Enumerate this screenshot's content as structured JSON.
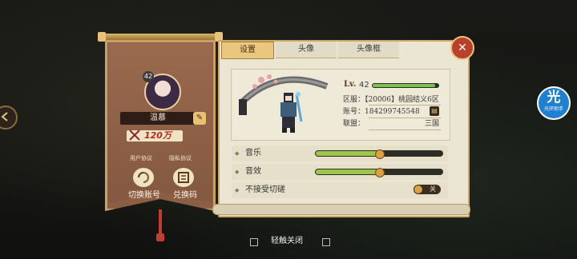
{
  "profile": {
    "level": "42",
    "name": "温慕",
    "power": "120万",
    "links": {
      "user_agreement": "用户协议",
      "privacy": "隐私协议"
    },
    "switch_account": "切换账号",
    "redeem_code": "兑换码"
  },
  "tabs": [
    {
      "label": "设置",
      "active": true
    },
    {
      "label": "头像",
      "active": false
    },
    {
      "label": "头像框",
      "active": false
    }
  ],
  "player": {
    "level_prefix": "Lv.",
    "level": "42",
    "xp_fraction": 0.95,
    "server": "区服：【20006】桃园结义6区",
    "account": "账号：184299745548",
    "alliance_label": "联盟：",
    "alliance_value": "三国"
  },
  "settings": {
    "music": {
      "label": "音乐",
      "value": 0.5
    },
    "sfx": {
      "label": "音效",
      "value": 0.5
    },
    "refuse_duel": {
      "label": "不接受切磋",
      "state": "关"
    }
  },
  "footer": {
    "close_hint": "轻触关闭"
  },
  "app_badge": {
    "glyph": "光",
    "caption": "光环助手"
  },
  "colors": {
    "accent": "#e9c77e",
    "slider_fill": "#9ec44a",
    "close": "#b7412d",
    "banner": "#8c5f45"
  }
}
